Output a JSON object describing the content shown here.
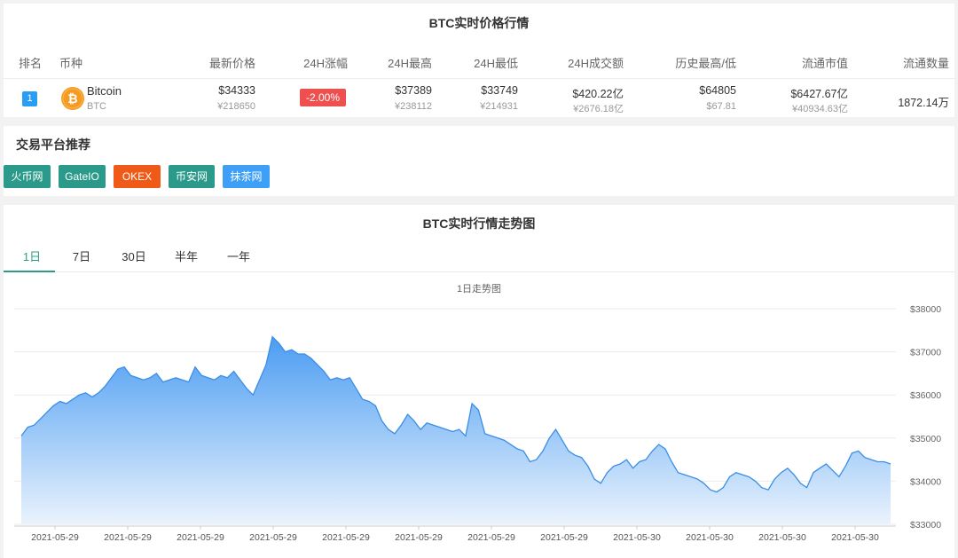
{
  "price_panel": {
    "title": "BTC实时价格行情",
    "headers": {
      "rank": "排名",
      "coin": "币种",
      "price": "最新价格",
      "change": "24H涨幅",
      "high": "24H最高",
      "low": "24H最低",
      "volume": "24H成交额",
      "ath_atl": "历史最高/低",
      "market_cap": "流通市值",
      "supply": "流通数量"
    },
    "row": {
      "rank": "1",
      "name": "Bitcoin",
      "symbol": "BTC",
      "price_usd": "$34333",
      "price_cny": "¥218650",
      "change": "-2.00%",
      "high_usd": "$37389",
      "high_cny": "¥238112",
      "low_usd": "$33749",
      "low_cny": "¥214931",
      "volume_usd": "$420.22亿",
      "volume_cny": "¥2676.18亿",
      "ath": "$64805",
      "atl": "$67.81",
      "mcap_usd": "$6427.67亿",
      "mcap_cny": "¥40934.63亿",
      "supply": "1872.14万"
    },
    "coin_icon": "bitcoin-icon"
  },
  "platforms": {
    "title": "交易平台推荐",
    "items": [
      {
        "label": "火币网",
        "color": "#2b9a8a"
      },
      {
        "label": "GateIO",
        "color": "#2b9a8a"
      },
      {
        "label": "OKEX",
        "color": "#f05a18"
      },
      {
        "label": "币安网",
        "color": "#2b9a8a"
      },
      {
        "label": "抹茶网",
        "color": "#3d9ff5"
      }
    ]
  },
  "trend_panel": {
    "title": "BTC实时行情走势图",
    "tabs": [
      "1日",
      "7日",
      "30日",
      "半年",
      "一年"
    ],
    "active_tab": 0
  },
  "chart_data": {
    "type": "area",
    "title": "1日走势图",
    "ylim": [
      33000,
      38000
    ],
    "y_ticks": [
      33000,
      34000,
      35000,
      36000,
      37000,
      38000
    ],
    "y_tick_labels": [
      "$33000",
      "$34000",
      "$35000",
      "$36000",
      "$37000",
      "$38000"
    ],
    "x_tick_labels": [
      "2021-05-29",
      "2021-05-29",
      "2021-05-29",
      "2021-05-29",
      "2021-05-29",
      "2021-05-29",
      "2021-05-29",
      "2021-05-29",
      "2021-05-30",
      "2021-05-30",
      "2021-05-30",
      "2021-05-30"
    ],
    "grid": true,
    "line_color": "#3a8ee6",
    "fill_top_color": "#4b9cf2",
    "fill_bottom_color": "#eaf3fd",
    "values": [
      35050,
      35250,
      35300,
      35450,
      35600,
      35750,
      35850,
      35800,
      35900,
      36000,
      36050,
      35950,
      36050,
      36200,
      36400,
      36600,
      36650,
      36450,
      36400,
      36350,
      36400,
      36500,
      36300,
      36350,
      36400,
      36350,
      36300,
      36650,
      36450,
      36400,
      36350,
      36450,
      36400,
      36550,
      36350,
      36150,
      36000,
      36350,
      36700,
      37350,
      37200,
      37000,
      37050,
      36950,
      36950,
      36850,
      36700,
      36550,
      36350,
      36400,
      36350,
      36400,
      36150,
      35900,
      35850,
      35750,
      35400,
      35200,
      35100,
      35300,
      35550,
      35400,
      35200,
      35350,
      35300,
      35250,
      35200,
      35150,
      35200,
      35050,
      35800,
      35650,
      35100,
      35050,
      35000,
      34950,
      34850,
      34750,
      34700,
      34450,
      34500,
      34700,
      35000,
      35200,
      34950,
      34700,
      34600,
      34550,
      34350,
      34050,
      33950,
      34200,
      34350,
      34400,
      34500,
      34300,
      34450,
      34500,
      34700,
      34850,
      34750,
      34450,
      34200,
      34150,
      34100,
      34050,
      33950,
      33800,
      33750,
      33850,
      34100,
      34200,
      34150,
      34100,
      34000,
      33850,
      33800,
      34050,
      34200,
      34300,
      34150,
      33950,
      33850,
      34200,
      34300,
      34400,
      34250,
      34100,
      34350,
      34650,
      34700,
      34550,
      34500,
      34450,
      34450,
      34400
    ]
  }
}
